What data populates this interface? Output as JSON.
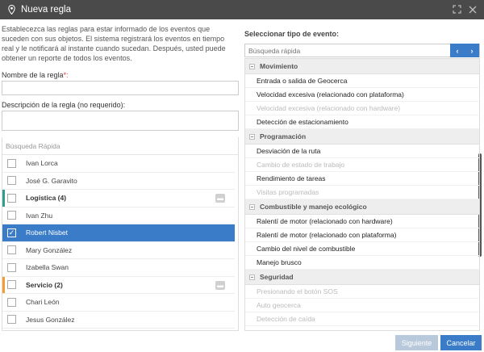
{
  "window": {
    "title": "Nueva regla"
  },
  "intro": {
    "text": "Establecezca las reglas para estar informado de los eventos que suceden con sus objetos. El sistema registrará los eventos en tiempo real y le notificará al instante cuando sucedan. Después, usted puede obtener un reporte de todos los eventos."
  },
  "form": {
    "name_label": "Nombre de la regla",
    "name_required": "*:",
    "name_value": "",
    "desc_label": "Descripción de la regla (no requerido):",
    "desc_value": ""
  },
  "objects": {
    "search_placeholder": "Búsqueda Rápida",
    "rows": [
      {
        "type": "item",
        "label": "Ivan Lorca",
        "checked": false
      },
      {
        "type": "item",
        "label": "José G. Garavito",
        "checked": false
      },
      {
        "type": "group",
        "label": "Logística (4)",
        "color": "#2e9e8f"
      },
      {
        "type": "item",
        "label": "Ivan Zhu",
        "checked": false
      },
      {
        "type": "item",
        "label": "Robert Nisbet",
        "checked": true,
        "selected": true
      },
      {
        "type": "item",
        "label": "Mary González",
        "checked": false
      },
      {
        "type": "item",
        "label": "Izabella Swan",
        "checked": false
      },
      {
        "type": "group",
        "label": "Servicio (2)",
        "color": "#f0a030"
      },
      {
        "type": "item",
        "label": "Chari León",
        "checked": false
      },
      {
        "type": "item",
        "label": "Jesus González",
        "checked": false
      }
    ]
  },
  "events": {
    "heading": "Seleccionar tipo de evento:",
    "search_placeholder": "Búsqueda rápida",
    "prev": "‹",
    "next": "›",
    "categories": [
      {
        "name": "Movimiento",
        "items": [
          {
            "label": "Entrada o salida de Geocerca",
            "enabled": true
          },
          {
            "label": "Velocidad excesiva (relacionado con plataforma)",
            "enabled": true
          },
          {
            "label": "Velocidad excesiva (relacionado con hardware)",
            "enabled": false
          },
          {
            "label": "Detección de estacionamiento",
            "enabled": true
          }
        ]
      },
      {
        "name": "Programación",
        "items": [
          {
            "label": "Desviación de la ruta",
            "enabled": true
          },
          {
            "label": "Cambio de estado de trabajo",
            "enabled": false
          },
          {
            "label": "Rendimiento de tareas",
            "enabled": true
          },
          {
            "label": "Visitas programadas",
            "enabled": false
          }
        ]
      },
      {
        "name": "Combustible y manejo ecológico",
        "items": [
          {
            "label": "Ralentí de motor (relacionado con hardware)",
            "enabled": true
          },
          {
            "label": "Ralentí de motor (relacionado con plataforma)",
            "enabled": true
          },
          {
            "label": "Cambio del nivel de combustible",
            "enabled": true
          },
          {
            "label": "Manejo brusco",
            "enabled": true
          }
        ]
      },
      {
        "name": "Seguridad",
        "items": [
          {
            "label": "Presionando el botón SOS",
            "enabled": false
          },
          {
            "label": "Auto geocerca",
            "enabled": false
          },
          {
            "label": "Detección de caída",
            "enabled": false
          }
        ]
      }
    ]
  },
  "footer": {
    "next_label": "Siguiente",
    "cancel_label": "Cancelar"
  },
  "colors": {
    "accent": "#3a7cc8",
    "titlebar": "#4a4a4a"
  }
}
